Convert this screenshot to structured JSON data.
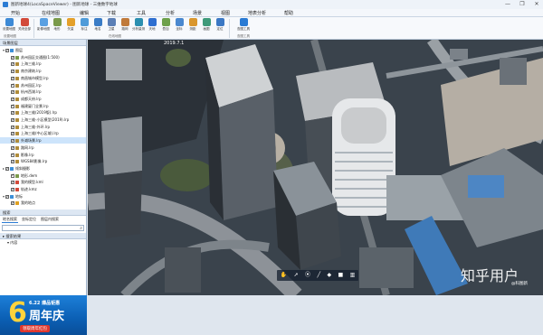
{
  "window": {
    "title": "图新地球4(LocaSpaceViewer) - 图新地球 - 三维数字地球",
    "controls": [
      "—",
      "❐",
      "✕"
    ]
  },
  "menu": [
    "开始",
    "在线地图",
    "编辑",
    "下载",
    "工具",
    "分析",
    "场景",
    "视图",
    "地表分析",
    "帮助"
  ],
  "ribbon": {
    "buttons": [
      "设置地图",
      "关闭全部",
      "影像地图",
      "地形",
      "矢量",
      "标注",
      "地名",
      "卫星",
      "路网",
      "分析量测",
      "天地",
      "叠加",
      "坐标",
      "测距",
      "画图",
      "定位",
      "地图",
      "三维",
      "查图工具"
    ],
    "groups": [
      "设置地图",
      "在线地图",
      "查图工具"
    ]
  },
  "left_panel": {
    "header": "场景图层",
    "tree": [
      {
        "label": "图层",
        "checked": true,
        "color": "#3c8fd8",
        "expand": "▾",
        "indent": 0
      },
      {
        "label": "苏州园区交通图(1:500)",
        "checked": true,
        "color": "#7a9a4a",
        "expand": "",
        "indent": 1
      },
      {
        "label": "上海三维.lrp",
        "checked": true,
        "color": "#b08c3a",
        "expand": "",
        "indent": 1
      },
      {
        "label": "南京建筑.lrp",
        "checked": true,
        "color": "#b08c3a",
        "expand": "",
        "indent": 1
      },
      {
        "label": "南昌城市模型.lrp",
        "checked": true,
        "color": "#b08c3a",
        "expand": "",
        "indent": 1
      },
      {
        "label": "苏州园区.lrp",
        "checked": true,
        "color": "#b08c3a",
        "expand": "",
        "indent": 1
      },
      {
        "label": "杭州西湖.lrp",
        "checked": true,
        "color": "#b08c3a",
        "expand": "",
        "indent": 1
      },
      {
        "label": "成都天府.lrp",
        "checked": true,
        "color": "#b08c3a",
        "expand": "",
        "indent": 1
      },
      {
        "label": "福建厦门全景.lrp",
        "checked": true,
        "color": "#b08c3a",
        "expand": "",
        "indent": 1
      },
      {
        "label": "上海三维(2019版).lrp",
        "checked": true,
        "color": "#b08c3a",
        "expand": "",
        "indent": 1
      },
      {
        "label": "上海三维-小区模型(2019).lrp",
        "checked": true,
        "color": "#b08c3a",
        "expand": "",
        "indent": 1
      },
      {
        "label": "上海三维-外环.lrp",
        "checked": true,
        "color": "#b08c3a",
        "expand": "",
        "indent": 1
      },
      {
        "label": "上海三维(中心区域).lrp",
        "checked": true,
        "color": "#b08c3a",
        "expand": "",
        "indent": 1
      },
      {
        "label": "外滩场景.lrp",
        "checked": true,
        "color": "#b08c3a",
        "expand": "",
        "indent": 1,
        "selected": true
      },
      {
        "label": "路网.lrp",
        "checked": true,
        "color": "#b08c3a",
        "expand": "",
        "indent": 1
      },
      {
        "label": "影像.lrp",
        "checked": true,
        "color": "#b08c3a",
        "expand": "",
        "indent": 1
      },
      {
        "label": "WGS84影像.lrp",
        "checked": true,
        "color": "#b08c3a",
        "expand": "",
        "indent": 1
      },
      {
        "label": "倾斜摄影",
        "checked": true,
        "color": "#3c8fd8",
        "expand": "▸",
        "indent": 0
      },
      {
        "label": "地形.dem",
        "checked": true,
        "color": "#7a9a4a",
        "expand": "",
        "indent": 1
      },
      {
        "label": "我的模型.kml",
        "checked": true,
        "color": "#d24a3a",
        "expand": "",
        "indent": 1
      },
      {
        "label": "轨迹.kmz",
        "checked": true,
        "color": "#d24a3a",
        "expand": "",
        "indent": 1
      },
      {
        "label": "地标",
        "checked": true,
        "color": "#3c8fd8",
        "expand": "▾",
        "indent": 0
      },
      {
        "label": "我的地点",
        "checked": true,
        "color": "#e0a020",
        "expand": "",
        "indent": 1
      }
    ],
    "search_header": "搜索",
    "search_tabs": [
      "地名搜索",
      "坐标定位",
      "图层内搜索"
    ],
    "search_placeholder": "",
    "result_header": "▸ 搜索结果",
    "result_row": "▾ 内容",
    "ad": {
      "big": "6",
      "top": "6.22 爆品钜惠",
      "main": "周年庆",
      "bottom": "领取周年红包"
    }
  },
  "map": {
    "date_label": "2019.7.1",
    "toolbar_icons": [
      "hand-icon",
      "pointer-icon",
      "marker-icon",
      "line-icon",
      "polygon-icon",
      "square-icon",
      "chart-icon"
    ],
    "toolbar_glyphs": [
      "✋",
      "➚",
      "⦿",
      "╱",
      "◆",
      "■",
      "▥"
    ],
    "watermark": "知乎用户",
    "watermark_sub": "@科图新"
  }
}
